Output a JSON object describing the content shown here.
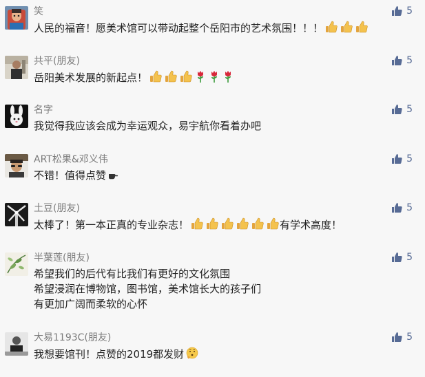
{
  "colors": {
    "like": "#576b95",
    "name": "#7b7b7b",
    "text": "#222222",
    "background": "#f7f7f7"
  },
  "comments": [
    {
      "name": "笑",
      "lines": [
        "人民的福音！愿美术馆可以带动起整个岳阳市的艺术氛围！！！"
      ],
      "trailing_icons": [
        "thumbs-up",
        "thumbs-up",
        "thumbs-up"
      ],
      "likes": "5"
    },
    {
      "name": "共平(朋友)",
      "lines": [
        "岳阳美术发展的新起点！"
      ],
      "trailing_icons": [
        "thumbs-up",
        "thumbs-up",
        "thumbs-up",
        "rose",
        "rose",
        "rose"
      ],
      "likes": "5"
    },
    {
      "name": "名字",
      "lines": [
        "我觉得我应该会成为幸运观众，易宇航你看着办吧"
      ],
      "trailing_icons": [],
      "likes": "5"
    },
    {
      "name": "ART松果&邓义伟",
      "lines": [
        "不错！值得点赞"
      ],
      "trailing_icons": [
        "pointing-hand"
      ],
      "likes": "5"
    },
    {
      "name": "土豆(朋友)",
      "lines": [
        "太棒了！第一本正真的专业杂志！"
      ],
      "trailing_icons": [
        "thumbs-up",
        "thumbs-up",
        "thumbs-up",
        "thumbs-up",
        "thumbs-up",
        "thumbs-up"
      ],
      "trailing_text": "有学术高度！",
      "likes": "5"
    },
    {
      "name": "半葉莲(朋友)",
      "lines": [
        "希望我们的后代有比我们有更好的文化氛围",
        "希望浸润在博物馆，图书馆，美术馆长大的孩子们",
        "有更加广阔而柔软的心怀"
      ],
      "trailing_icons": [],
      "likes": "5"
    },
    {
      "name": "大易1193C(朋友)",
      "lines": [
        "我想要馆刊！点赞的2019都发财"
      ],
      "trailing_icons": [
        "thinking-face"
      ],
      "likes": "5"
    }
  ]
}
